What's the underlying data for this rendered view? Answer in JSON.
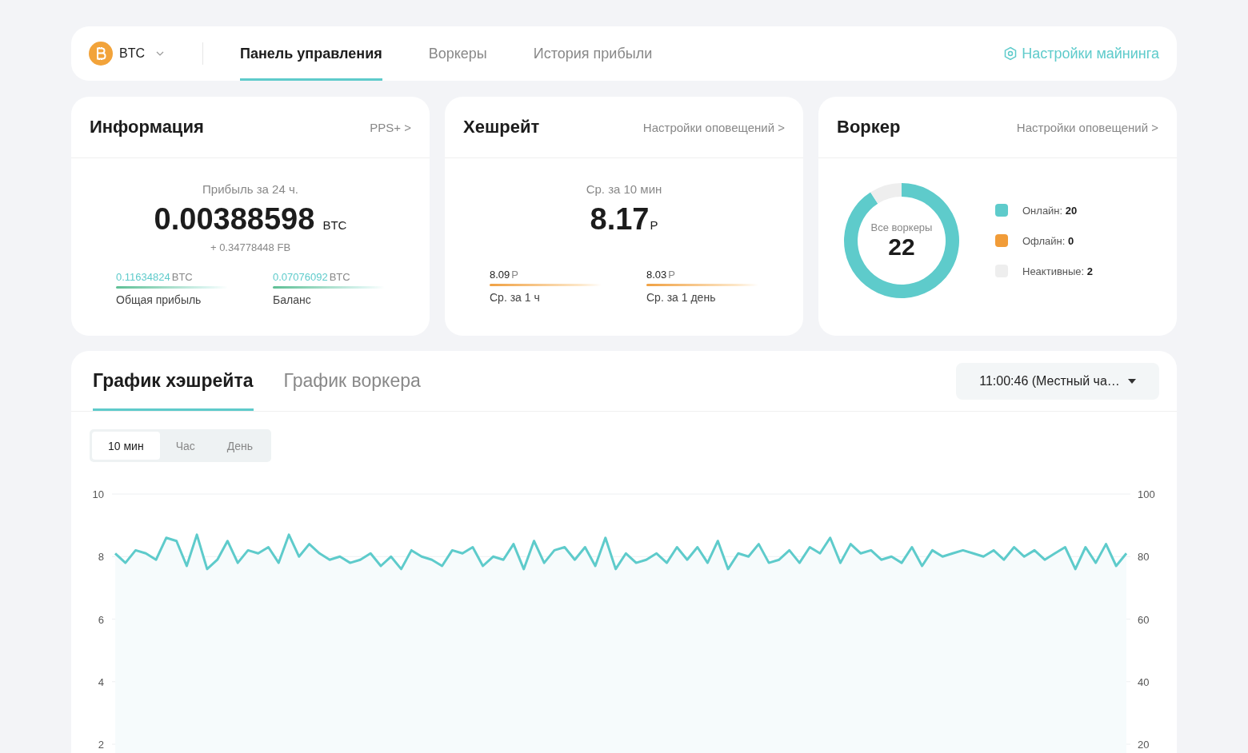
{
  "topbar": {
    "coin": "BTC",
    "tabs": [
      {
        "label": "Панель управления",
        "selected": true
      },
      {
        "label": "Воркеры",
        "selected": false
      },
      {
        "label": "История прибыли",
        "selected": false
      }
    ],
    "settings_link": "Настройки майнинга"
  },
  "info": {
    "title": "Информация",
    "link": "PPS+ >",
    "caption": "Прибыль за 24 ч.",
    "value": "0.00388598",
    "unit": "BTC",
    "extra": "+ 0.34778448 FB",
    "stats": [
      {
        "value": "0.11634824",
        "unit": "BTC",
        "label": "Общая прибыль"
      },
      {
        "value": "0.07076092",
        "unit": "BTC",
        "label": "Баланс"
      }
    ]
  },
  "hashrate": {
    "title": "Хешрейт",
    "link": "Настройки оповещений >",
    "caption": "Ср. за 10 мин",
    "value": "8.17",
    "unit": "P",
    "stats": [
      {
        "value": "8.09",
        "unit": "P",
        "label": "Ср. за 1 ч"
      },
      {
        "value": "8.03",
        "unit": "P",
        "label": "Ср. за 1 день"
      }
    ]
  },
  "workers": {
    "title": "Воркер",
    "link": "Настройки оповещений >",
    "center_label": "Все воркеры",
    "total": "22",
    "chart_data": {
      "type": "donut",
      "values": [
        90.91,
        0,
        9.09
      ]
    },
    "legend": [
      {
        "label": "Онлайн:",
        "value": "20",
        "color": "#5ecbcb"
      },
      {
        "label": "Офлайн:",
        "value": "0",
        "color": "#f19c38"
      },
      {
        "label": "Неактивные:",
        "value": "2",
        "color": "#eeeeee"
      }
    ]
  },
  "chart_panel": {
    "tabs": [
      {
        "label": "График хэшрейта",
        "selected": true
      },
      {
        "label": "График воркера",
        "selected": false
      }
    ],
    "time_select": "11:00:46 (Местный ча…",
    "ranges": [
      {
        "label": "10 мин",
        "selected": true
      },
      {
        "label": "Час",
        "selected": false
      },
      {
        "label": "День",
        "selected": false
      }
    ],
    "right_axis_labels": [
      "100",
      "80",
      "60",
      "40",
      "20"
    ],
    "chart_data": {
      "type": "line",
      "grid": true,
      "yticks": [
        2,
        4,
        6,
        8,
        10
      ],
      "ylim": [
        2,
        10
      ],
      "series": [
        {
          "color": "#5ecbcb",
          "values": [
            8.1,
            7.8,
            8.2,
            8.1,
            7.9,
            8.6,
            8.5,
            7.7,
            8.7,
            7.6,
            7.9,
            8.5,
            7.8,
            8.2,
            8.1,
            8.3,
            7.8,
            8.7,
            8.0,
            8.4,
            8.1,
            7.9,
            8.0,
            7.8,
            7.9,
            8.1,
            7.7,
            8.0,
            7.6,
            8.2,
            8.0,
            7.9,
            7.7,
            8.2,
            8.1,
            8.3,
            7.7,
            8.0,
            7.9,
            8.4,
            7.6,
            8.5,
            7.8,
            8.2,
            8.3,
            7.9,
            8.3,
            7.7,
            8.6,
            7.6,
            8.1,
            7.8,
            7.9,
            8.1,
            7.8,
            8.3,
            7.9,
            8.3,
            7.8,
            8.5,
            7.6,
            8.1,
            8.0,
            8.4,
            7.8,
            7.9,
            8.2,
            7.8,
            8.3,
            8.1,
            8.6,
            7.8,
            8.4,
            8.1,
            8.2,
            7.9,
            8.0,
            7.8,
            8.3,
            7.7,
            8.2,
            8.0,
            8.1,
            8.2,
            8.1,
            8.0,
            8.2,
            7.9,
            8.3,
            8.0,
            8.2,
            7.9,
            8.1,
            8.3,
            7.6,
            8.3,
            7.8,
            8.4,
            7.7,
            8.1
          ]
        }
      ]
    }
  }
}
